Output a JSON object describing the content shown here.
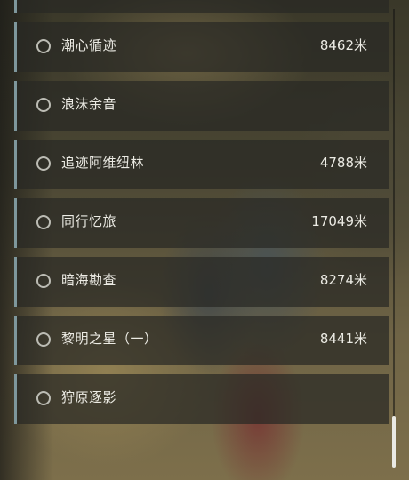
{
  "quests": [
    {
      "name": "潮心循迹",
      "distance": "8462米",
      "selected": false
    },
    {
      "name": "浪沫余音",
      "distance": "",
      "selected": false
    },
    {
      "name": "追迹阿维纽林",
      "distance": "4788米",
      "selected": false
    },
    {
      "name": "同行忆旅",
      "distance": "17049米",
      "selected": false
    },
    {
      "name": "暗海勘查",
      "distance": "8274米",
      "selected": false
    },
    {
      "name": "黎明之星（一）",
      "distance": "8441米",
      "selected": false
    },
    {
      "name": "狩原逐影",
      "distance": "",
      "selected": false
    }
  ],
  "colors": {
    "item_background": "rgba(40,40,36,0.72)",
    "accent_border": "#7e979c",
    "text": "#ecebe4",
    "radio": "#bcbcb4",
    "scroll_thumb": "#e9e9e4"
  },
  "icons": {
    "radio": "radio-unchecked-icon"
  },
  "scroll": {
    "position_fraction": 1.0
  }
}
